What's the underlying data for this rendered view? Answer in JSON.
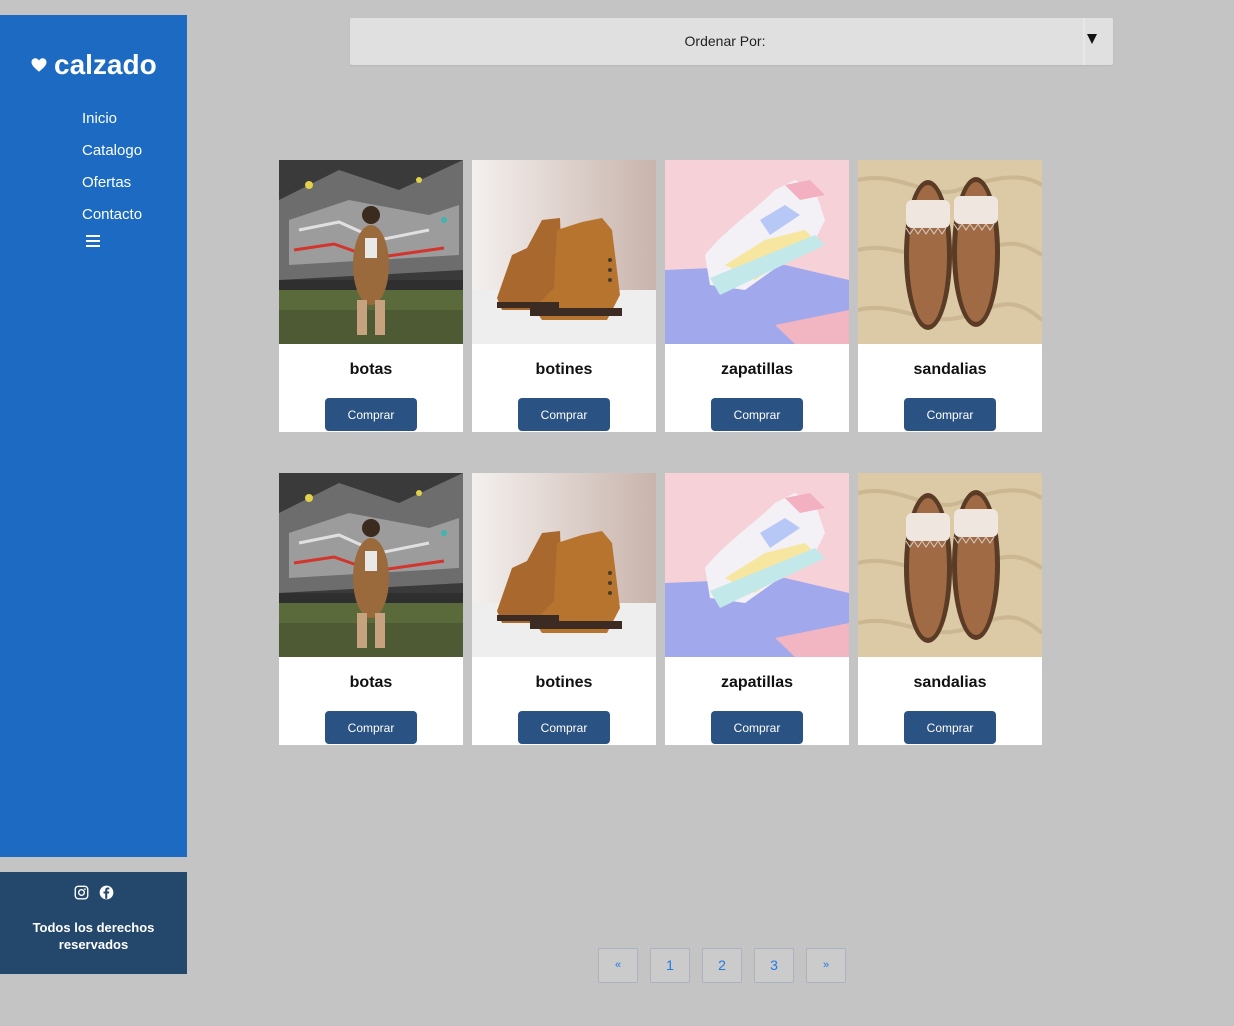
{
  "brand": {
    "name": "calzado"
  },
  "nav": {
    "items": [
      {
        "label": "Inicio"
      },
      {
        "label": "Catalogo"
      },
      {
        "label": "Ofertas"
      },
      {
        "label": "Contacto"
      }
    ]
  },
  "footer": {
    "text": "Todos los derechos reservados",
    "social": [
      "instagram-icon",
      "facebook-icon"
    ]
  },
  "sort": {
    "label": "Ordenar Por:"
  },
  "products": {
    "row1": [
      {
        "title": "botas",
        "button": "Comprar"
      },
      {
        "title": "botines",
        "button": "Comprar"
      },
      {
        "title": "zapatillas",
        "button": "Comprar"
      },
      {
        "title": "sandalias",
        "button": "Comprar"
      }
    ],
    "row2": [
      {
        "title": "botas",
        "button": "Comprar"
      },
      {
        "title": "botines",
        "button": "Comprar"
      },
      {
        "title": "zapatillas",
        "button": "Comprar"
      },
      {
        "title": "sandalias",
        "button": "Comprar"
      }
    ]
  },
  "pagination": {
    "prev": "«",
    "pages": [
      "1",
      "2",
      "3"
    ],
    "next": "»"
  },
  "colors": {
    "sidebar": "#1c6ac2",
    "footer": "#24476c",
    "button": "#2a5282",
    "page_link": "#1e7be4",
    "background": "#c4c4c4"
  }
}
